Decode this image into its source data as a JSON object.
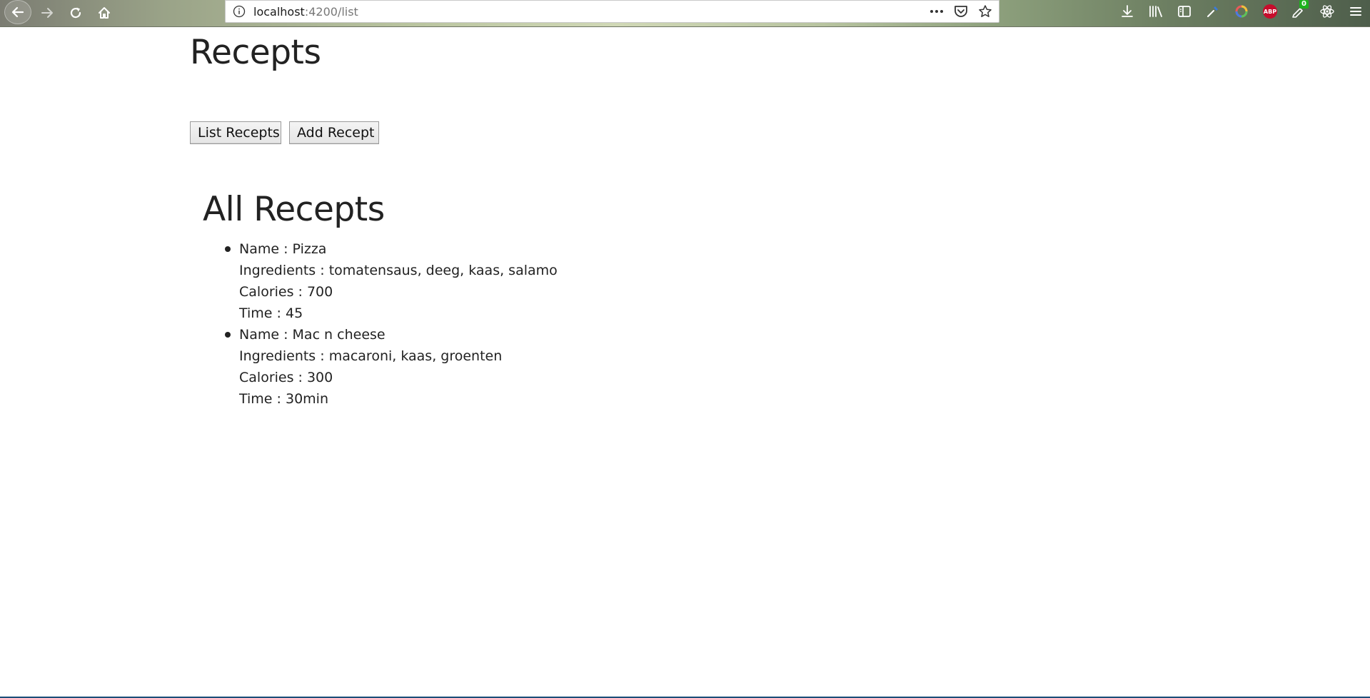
{
  "browser": {
    "url_host": "localhost",
    "url_path": ":4200/list",
    "ext_badge_count": "0",
    "abp_label": "ABP"
  },
  "app": {
    "title": "Recepts",
    "buttons": {
      "list_label": "List Recepts",
      "add_label": "Add Recept"
    },
    "list_title": "All Recepts",
    "recipes": [
      {
        "name": "Name : Pizza",
        "ingredients": "Ingredients : tomatensaus, deeg, kaas, salamo",
        "calories": "Calories : 700",
        "time": "Time : 45"
      },
      {
        "name": "Name : Mac n cheese",
        "ingredients": "Ingredients : macaroni, kaas, groenten",
        "calories": "Calories : 300",
        "time": "Time : 30min"
      }
    ]
  },
  "icons": {
    "back": "back-arrow-icon",
    "forward": "forward-arrow-icon",
    "reload": "reload-icon",
    "home": "home-icon",
    "info": "info-icon",
    "more": "more-icon",
    "pocket": "pocket-icon",
    "bookmark": "star-icon"
  }
}
